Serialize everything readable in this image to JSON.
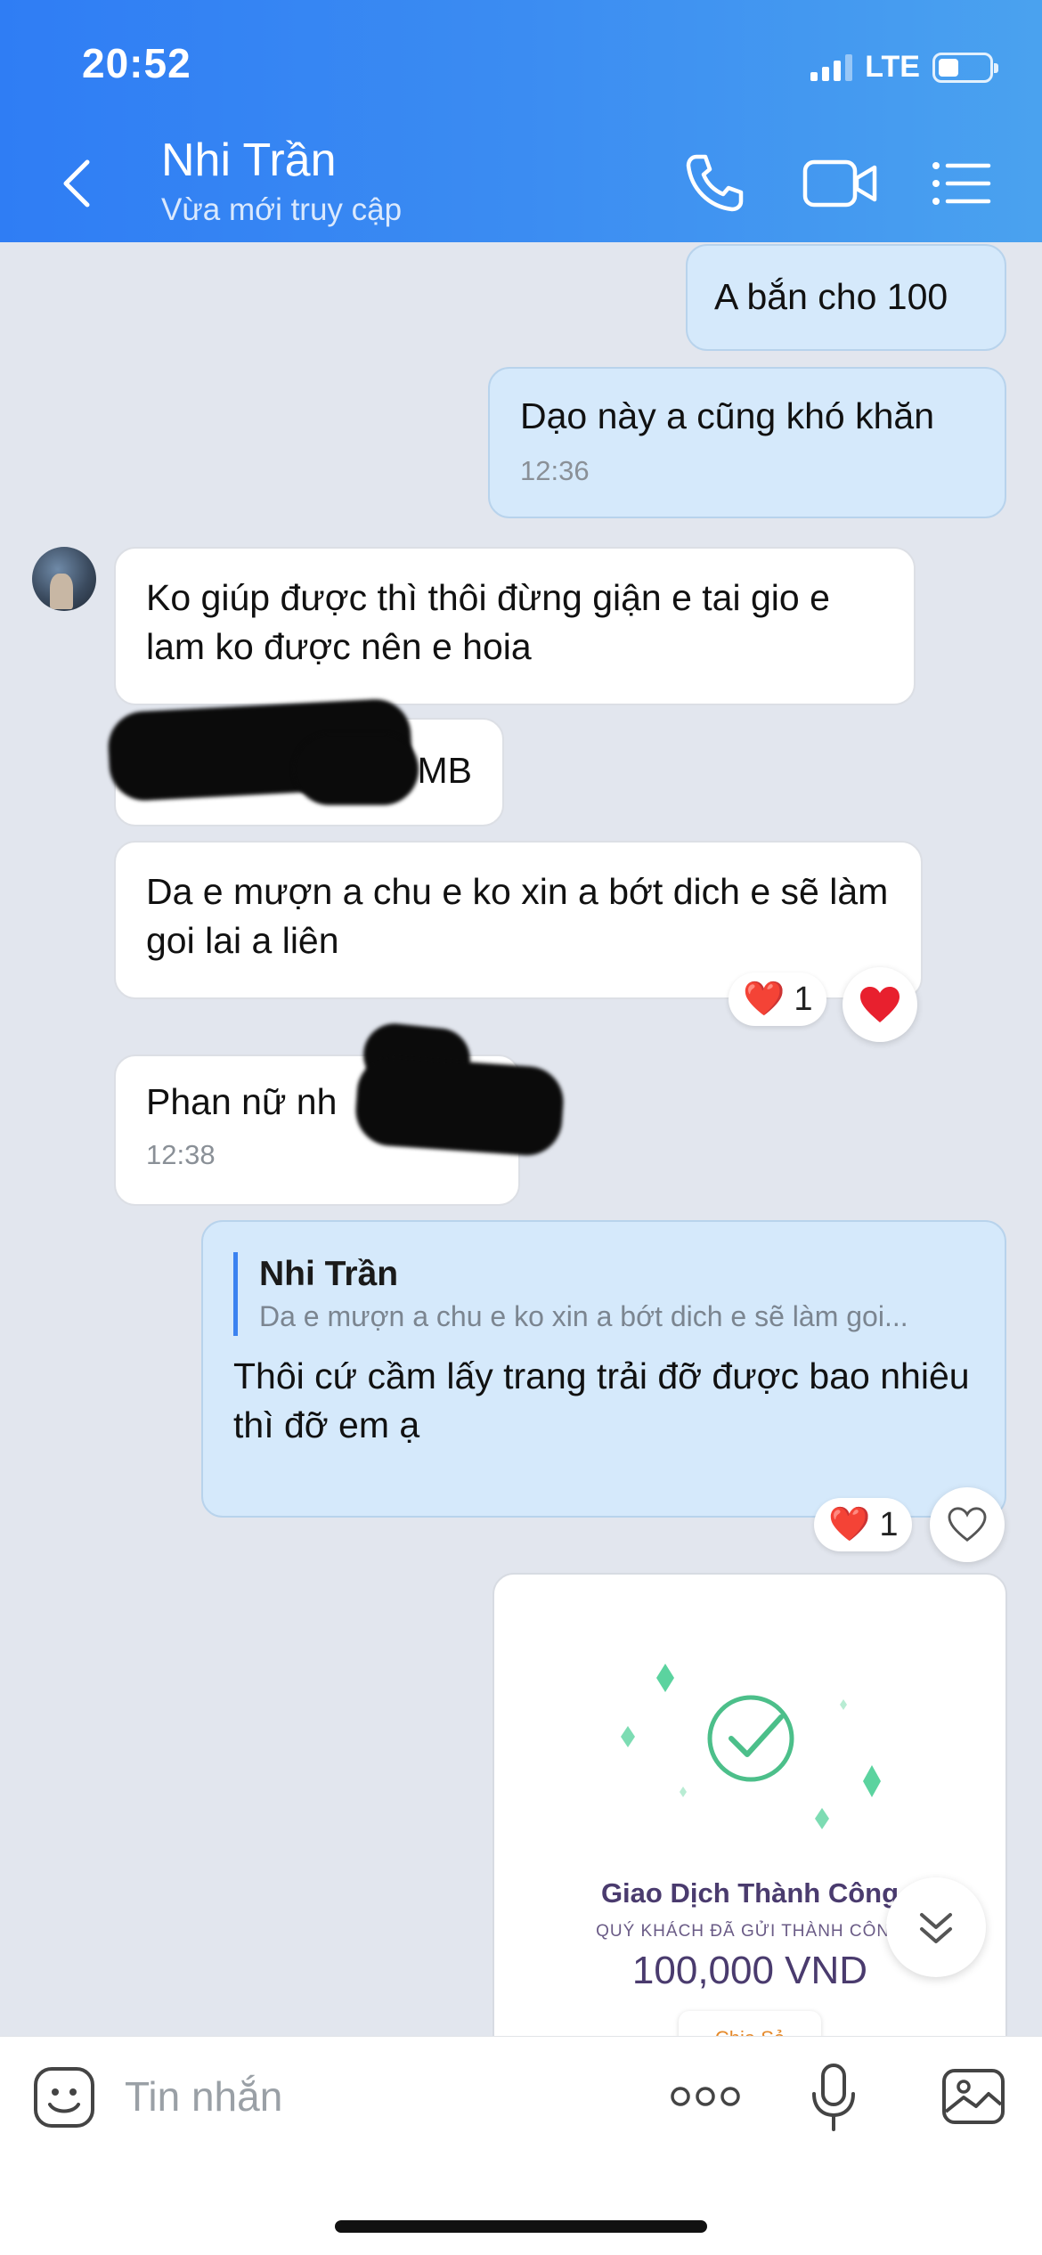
{
  "status_bar": {
    "time": "20:52",
    "network": "LTE"
  },
  "header": {
    "back_icon": "chevron-left-icon",
    "contact_name": "Nhi Trần",
    "contact_status": "Vừa mới truy cập",
    "icons": [
      "phone-icon",
      "video-camera-icon",
      "list-menu-icon"
    ]
  },
  "messages": [
    {
      "dir": "out",
      "text": "A bắn cho 100"
    },
    {
      "dir": "out",
      "text": "Dạo này a cũng khó khăn",
      "time": "12:36"
    },
    {
      "dir": "in",
      "text": "Ko giúp được thì thôi đừng giận e tai gio e lam ko được nên e hoia"
    },
    {
      "dir": "in",
      "text": "MB",
      "redacted": true
    },
    {
      "dir": "in",
      "text": "Da e mượn a chu e ko xin a bớt dich e sẽ làm goi lai a liên",
      "reaction": {
        "emoji": "❤️",
        "count": "1"
      }
    },
    {
      "dir": "in",
      "text": "Phan nữ nh",
      "time": "12:38",
      "redacted": true
    },
    {
      "dir": "out",
      "reply_to": {
        "name": "Nhi Trần",
        "text": "Da e mượn a chu e ko xin a bớt dich e sẽ làm goi..."
      },
      "text": "Thôi cứ cầm lấy trang trải đỡ được bao nhiêu thì đỡ em ạ",
      "reaction": {
        "emoji": "❤️",
        "count": "1"
      }
    }
  ],
  "transaction_card": {
    "title": "Giao Dịch Thành Công",
    "subtitle": "QUÝ KHÁCH ĐÃ GỬI THÀNH CÔNG",
    "amount": "100,000 VND",
    "share_label": "Chia Sẻ",
    "colors": {
      "check": "#4cbf8a",
      "title": "#4a3b6e"
    }
  },
  "composer": {
    "placeholder": "Tin nhắn",
    "icons": [
      "emoji-icon",
      "more-icon",
      "microphone-icon",
      "gallery-icon"
    ]
  },
  "colors": {
    "header_start": "#2f7df4",
    "header_end": "#4aa2ef",
    "outgoing_bubble": "#d5e9fb",
    "background": "#e2e6ee",
    "heart": "#e8202e"
  }
}
